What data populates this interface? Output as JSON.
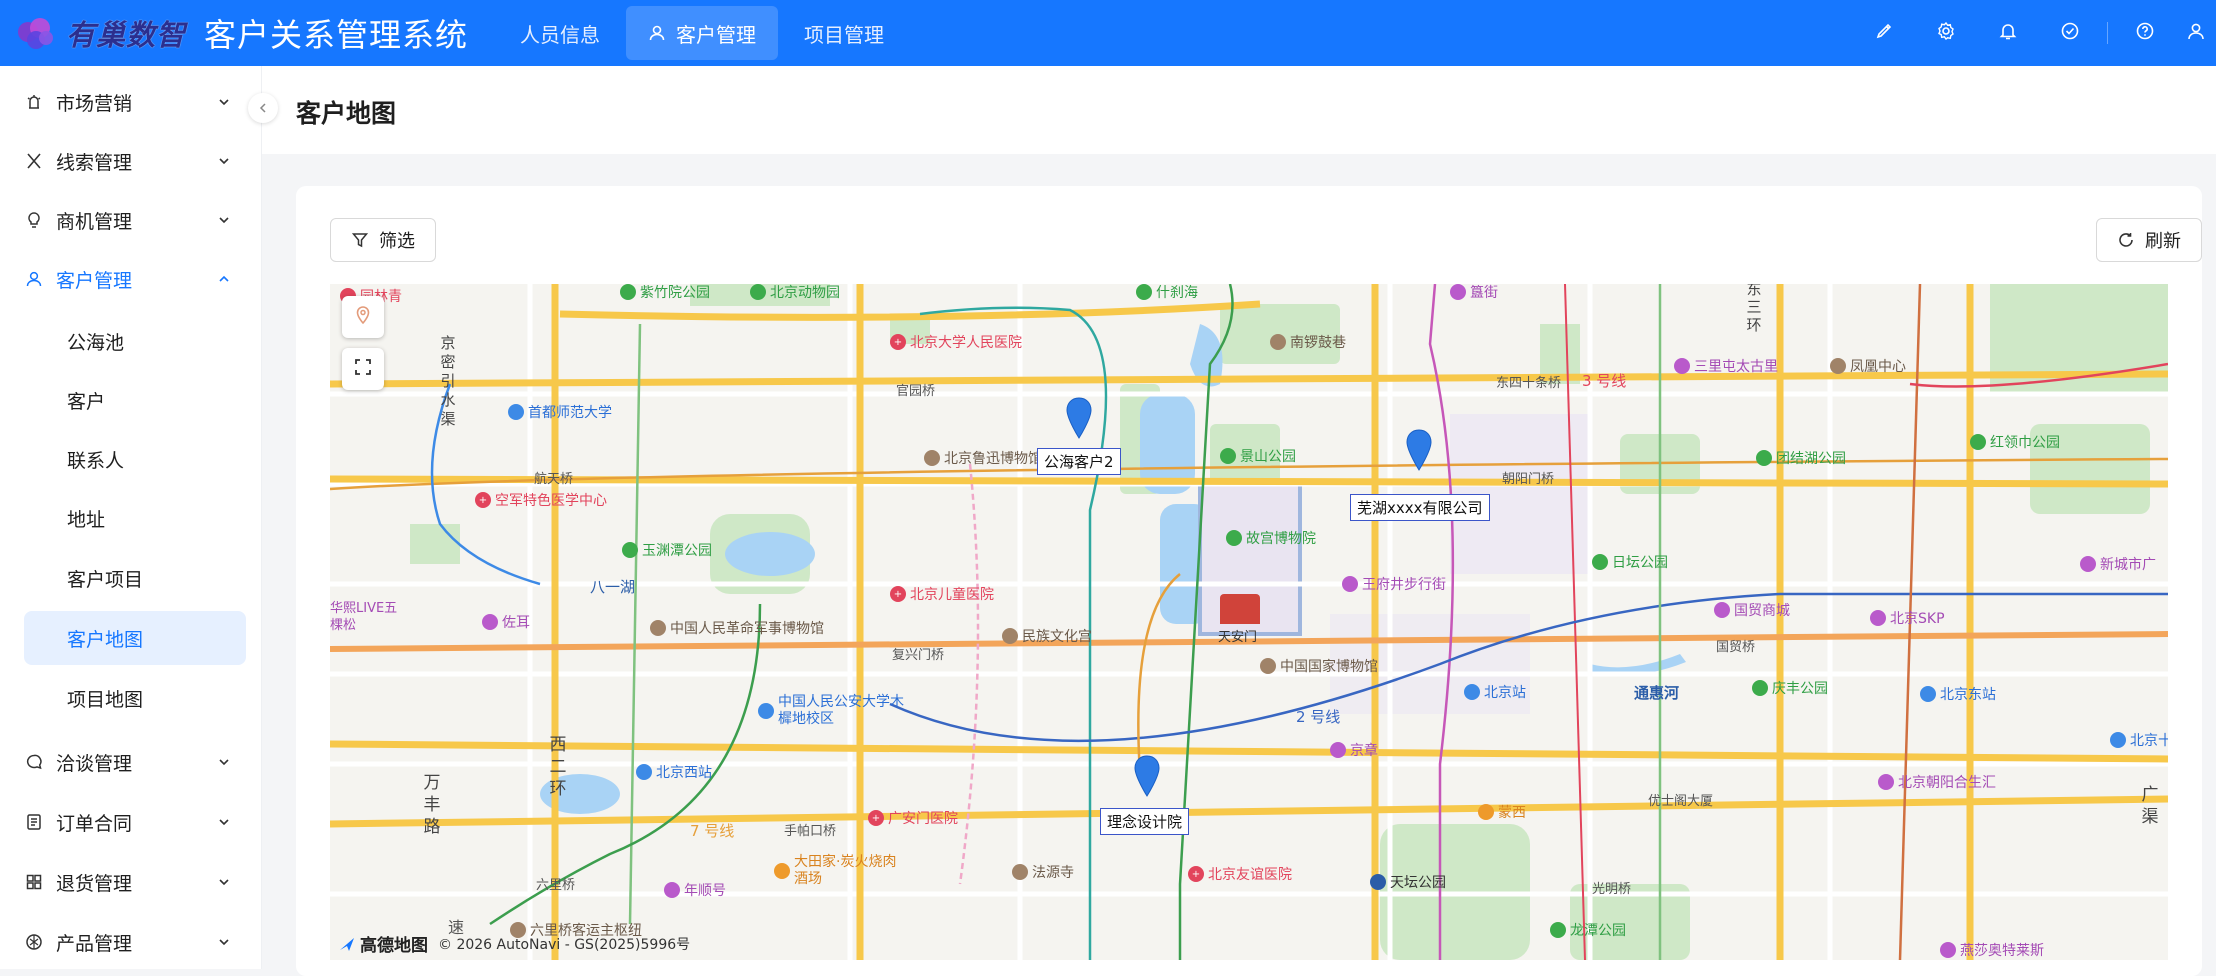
{
  "header": {
    "logo_text": "有巢数智",
    "app_title": "客户关系管理系统",
    "tabs": [
      {
        "label": "人员信息",
        "active": false
      },
      {
        "label": "客户管理",
        "active": true
      },
      {
        "label": "项目管理",
        "active": false
      }
    ],
    "actions": [
      "brush-icon",
      "gear-icon",
      "bell-icon",
      "check-circle-icon",
      "help-icon",
      "user-icon"
    ],
    "accent_color": "#1677ff"
  },
  "sidebar": {
    "menus": [
      {
        "label": "市场营销",
        "icon": "megaphone-icon",
        "open": false
      },
      {
        "label": "线索管理",
        "icon": "x-icon",
        "open": false
      },
      {
        "label": "商机管理",
        "icon": "bulb-icon",
        "open": false
      },
      {
        "label": "客户管理",
        "icon": "user-icon",
        "open": true
      }
    ],
    "submenu": [
      {
        "label": "公海池",
        "active": false
      },
      {
        "label": "客户",
        "active": false
      },
      {
        "label": "联系人",
        "active": false
      },
      {
        "label": "地址",
        "active": false
      },
      {
        "label": "客户项目",
        "active": false
      },
      {
        "label": "客户地图",
        "active": true
      },
      {
        "label": "项目地图",
        "active": false
      }
    ],
    "menus_bottom": [
      {
        "label": "洽谈管理",
        "icon": "chat-icon"
      },
      {
        "label": "订单合同",
        "icon": "document-icon"
      },
      {
        "label": "退货管理",
        "icon": "grid-icon"
      },
      {
        "label": "产品管理",
        "icon": "product-icon"
      }
    ]
  },
  "page": {
    "title": "客户地图",
    "filter_label": "筛选",
    "refresh_label": "刷新"
  },
  "map": {
    "markers": [
      {
        "label": "公海客户2"
      },
      {
        "label": "芜湖xxxx有限公司"
      },
      {
        "label": "理念设计院"
      }
    ],
    "pois": {
      "p1": "北京大学人民医院",
      "p2": "南锣鼓巷",
      "p3": "三里屯太古里",
      "p4": "凤凰中心",
      "p5": "首都师范大学",
      "p6": "北京鲁迅博物馆",
      "p7": "景山公园",
      "p8": "团结湖公园",
      "p9": "红领巾公园",
      "p10": "空军特色医学中心",
      "p11": "玉渊潭公园",
      "p12": "故宫博物院",
      "p13": "日坛公园",
      "p14": "北京儿童医院",
      "p15": "王府井步行街",
      "p16": "国贸商城",
      "p17": "北京SKP",
      "p18": "新城市广",
      "p19": "中国人民革命军事博物馆",
      "p20": "民族文化宫",
      "p21": "天安门",
      "p22": "中国国家博物馆",
      "p23": "佐耳",
      "p24": "中国人民公安大学木樨地校区",
      "p25": "北京站",
      "p26": "庆丰公园",
      "p27": "北京东站",
      "p28": "北京西站",
      "p29": "京章",
      "p30": "广安门医院",
      "p31": "蒙西",
      "p32": "北京朝阳合生汇",
      "p33": "大田家·炭火烧肉酒场",
      "p34": "年顺号",
      "p35": "法源寺",
      "p36": "北京友谊医院",
      "p37": "天坛公园",
      "p38": "六里桥客运主枢纽",
      "p39": "龙潭公园",
      "p40": "燕莎奥特莱斯",
      "p41": "紫竹院公园",
      "p42": "北京动物园",
      "p43": "什刹海",
      "p44": "簋街",
      "p45": "园林青",
      "p46": "北京十"
    },
    "labels": {
      "l1": "京密引水渠",
      "l2": "西二环",
      "l3": "万丰路",
      "l4": "东三环",
      "l5": "3 号线",
      "l6": "2 号线",
      "l7": "7 号线",
      "l8": "通惠河",
      "l9": "八一湖",
      "l10": "华熙LIVE五棵松",
      "l11": "官园桥",
      "l12": "航天桥",
      "l13": "复兴门桥",
      "l14": "朝阳门桥",
      "l15": "东四十条桥",
      "l16": "国贸桥",
      "l17": "优士阁大厦",
      "l18": "手帕口桥",
      "l19": "六里桥",
      "l20": "光明桥",
      "l21": "广渠",
      "l22": "速"
    },
    "attribution_logo": "高德地图",
    "attribution": "© 2026 AutoNavi - GS(2025)5996号"
  }
}
